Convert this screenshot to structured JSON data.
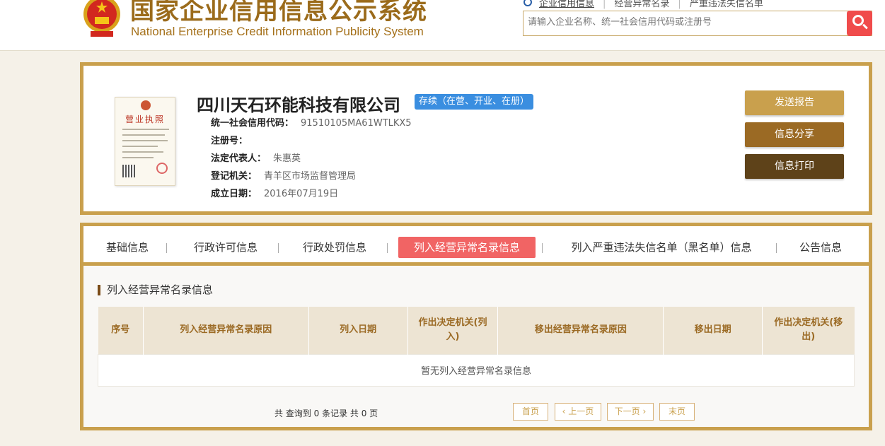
{
  "header": {
    "title_cn": "国家企业信用信息公示系统",
    "title_en": "National Enterprise Credit Information Publicity System",
    "top_links": [
      "企业信用信息",
      "经营异常名录",
      "严重违法失信名单"
    ],
    "search_placeholder": "请输入企业名称、统一社会信用代码或注册号"
  },
  "company": {
    "license_title": "营业执照",
    "name": "四川天石环能科技有限公司",
    "status": "存续（在营、开业、在册）",
    "fields": [
      {
        "label": "统一社会信用代码：",
        "value": "91510105MA61WTLKX5"
      },
      {
        "label": "注册号：",
        "value": ""
      },
      {
        "label": "法定代表人：",
        "value": "朱惠英"
      },
      {
        "label": "登记机关：",
        "value": "青羊区市场监督管理局"
      },
      {
        "label": "成立日期：",
        "value": "2016年07月19日"
      }
    ]
  },
  "actions": {
    "send_report": "发送报告",
    "share": "信息分享",
    "print": "信息打印"
  },
  "tabs": [
    {
      "label": "基础信息"
    },
    {
      "label": "行政许可信息"
    },
    {
      "label": "行政处罚信息"
    },
    {
      "label": "列入经营异常名录信息"
    },
    {
      "label": "列入严重违法失信名单（黑名单）信息"
    },
    {
      "label": "公告信息"
    }
  ],
  "section": {
    "title": "列入经营异常名录信息",
    "columns": [
      "序号",
      "列入经营异常名录原因",
      "列入日期",
      "作出决定机关(列入)",
      "移出经营异常名录原因",
      "移出日期",
      "作出决定机关(移出)"
    ],
    "empty_text": "暂无列入经营异常名录信息"
  },
  "pager": {
    "summary": "共 查询到 0 条记录 共 0 页",
    "first": "首页",
    "prev": "上一页",
    "next": "下一页",
    "last": "末页"
  },
  "colors": {
    "gold": "#c9a04d",
    "brown": "#9b6a24",
    "dark_brown": "#5e4219",
    "active_tab": "#f16464",
    "status_badge": "#3a8ee0",
    "search_button": "#f04b4b"
  }
}
